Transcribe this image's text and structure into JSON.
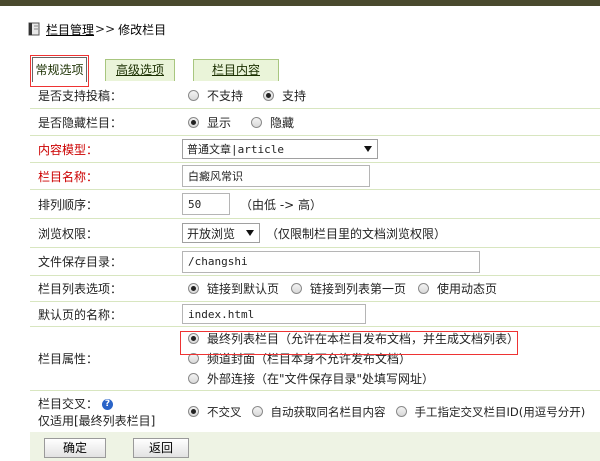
{
  "breadcrumb": {
    "parent": "栏目管理",
    "separator": ">>",
    "current": "修改栏目"
  },
  "tabs": [
    {
      "label": "常规选项"
    },
    {
      "label": "高级选项"
    },
    {
      "label": "栏目内容"
    }
  ],
  "form": {
    "submission": {
      "label": "是否支持投稿：",
      "options": [
        "不支持",
        "支持"
      ],
      "selected": "支持"
    },
    "hidden": {
      "label": "是否隐藏栏目：",
      "options": [
        "显示",
        "隐藏"
      ],
      "selected": "显示"
    },
    "content_model": {
      "label": "内容模型：",
      "value": "普通文章|article"
    },
    "name": {
      "label": "栏目名称：",
      "value": "白癜风常识"
    },
    "order": {
      "label": "排列顺序：",
      "value": "50",
      "hint": "（由低 -> 高）"
    },
    "browse": {
      "label": "浏览权限：",
      "value": "开放浏览",
      "hint": "（仅限制栏目里的文档浏览权限）"
    },
    "save_dir": {
      "label": "文件保存目录：",
      "value": "/changshi"
    },
    "list_option": {
      "label": "栏目列表选项：",
      "options": [
        "链接到默认页",
        "链接到列表第一页",
        "使用动态页"
      ],
      "selected": "链接到默认页"
    },
    "default_page": {
      "label": "默认页的名称：",
      "value": "index.html"
    },
    "attribute": {
      "label": "栏目属性：",
      "options": [
        "最终列表栏目（允许在本栏目发布文档，并生成文档列表）",
        "频道封面（栏目本身不允许发布文档）",
        "外部连接（在\"文件保存目录\"处填写网址）"
      ],
      "selected": "最终列表栏目（允许在本栏目发布文档，并生成文档列表）"
    },
    "cross": {
      "label_line1": "栏目交叉：",
      "label_line2": "仅适用[最终列表栏目]",
      "help_glyph": "?",
      "options": [
        "不交叉",
        "自动获取同名栏目内容",
        "手工指定交叉栏目ID(用逗号分开)"
      ],
      "selected": "不交叉"
    }
  },
  "buttons": {
    "confirm": "确定",
    "back": "返回"
  },
  "colors": {
    "required_label": "#cc0000",
    "highlight_box": "#ee3333",
    "tab_border": "#a8c67f",
    "row_line": "#d8e6c0"
  }
}
